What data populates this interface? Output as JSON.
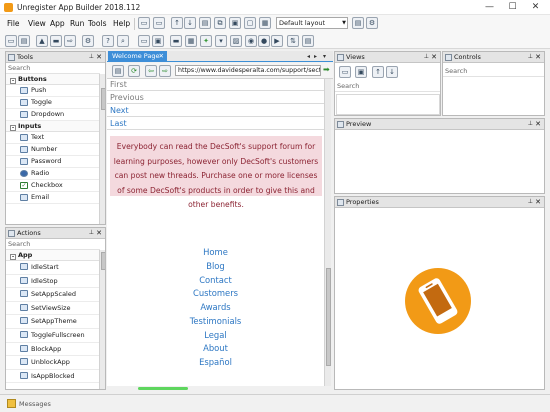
{
  "window": {
    "title": "Unregister App Builder 2018.112",
    "controls": {
      "minimize": "—",
      "maximize": "☐",
      "close": "✕"
    }
  },
  "menu": [
    "File",
    "View",
    "App",
    "Run",
    "Tools",
    "Help"
  ],
  "layout_select": {
    "value": "Default layout"
  },
  "tools_panel": {
    "title": "Tools",
    "search_placeholder": "Search",
    "groups": [
      {
        "name": "Buttons",
        "items": [
          {
            "label": "Push",
            "icon": "push-button-icon"
          },
          {
            "label": "Toggle",
            "icon": "toggle-icon"
          },
          {
            "label": "Dropdown",
            "icon": "dropdown-icon"
          }
        ]
      },
      {
        "name": "Inputs",
        "items": [
          {
            "label": "Text",
            "icon": "text-input-icon"
          },
          {
            "label": "Number",
            "icon": "number-input-icon"
          },
          {
            "label": "Password",
            "icon": "password-input-icon"
          },
          {
            "label": "Radio",
            "icon": "radio-icon"
          },
          {
            "label": "Checkbox",
            "icon": "checkbox-icon"
          },
          {
            "label": "Email",
            "icon": "email-input-icon"
          }
        ]
      }
    ]
  },
  "actions_panel": {
    "title": "Actions",
    "search_placeholder": "Search",
    "group": "App",
    "items": [
      "IdleStart",
      "IdleStop",
      "SetAppScaled",
      "SetViewSize",
      "SetAppTheme",
      "ToggleFullscreen",
      "BlockApp",
      "UnblockApp",
      "IsAppBlocked"
    ]
  },
  "editor": {
    "tab_label": "Welcome Page",
    "tab_close": "✕",
    "url": "https://www.davidesperalta.com/support/sectio",
    "top_links": [
      "First",
      "Previous",
      "Next",
      "Last"
    ],
    "notice": "Everybody can read the DecSoft's support forum for learning purposes, however only DecSoft's customers can post new threads. Purchase one or more licenses of some DecSoft's products in order to give this and other benefits.",
    "nav_links": [
      "Home",
      "Blog",
      "Contact",
      "Customers",
      "Awards",
      "Testimonials",
      "Legal",
      "About",
      "Español"
    ]
  },
  "views_panel": {
    "title": "Views",
    "search_placeholder": "Search"
  },
  "controls_panel": {
    "title": "Controls",
    "search_placeholder": "Search"
  },
  "preview_panel": {
    "title": "Preview"
  },
  "properties_panel": {
    "title": "Properties",
    "logo_icon": "phone-logo-icon",
    "logo_color": "#f29a16"
  },
  "status_bar": {
    "messages_label": "Messages"
  },
  "colors": {
    "accent": "#3d8ed8",
    "notice_bg": "#f4d9de",
    "notice_text": "#8b2332",
    "link": "#2d77c3"
  }
}
